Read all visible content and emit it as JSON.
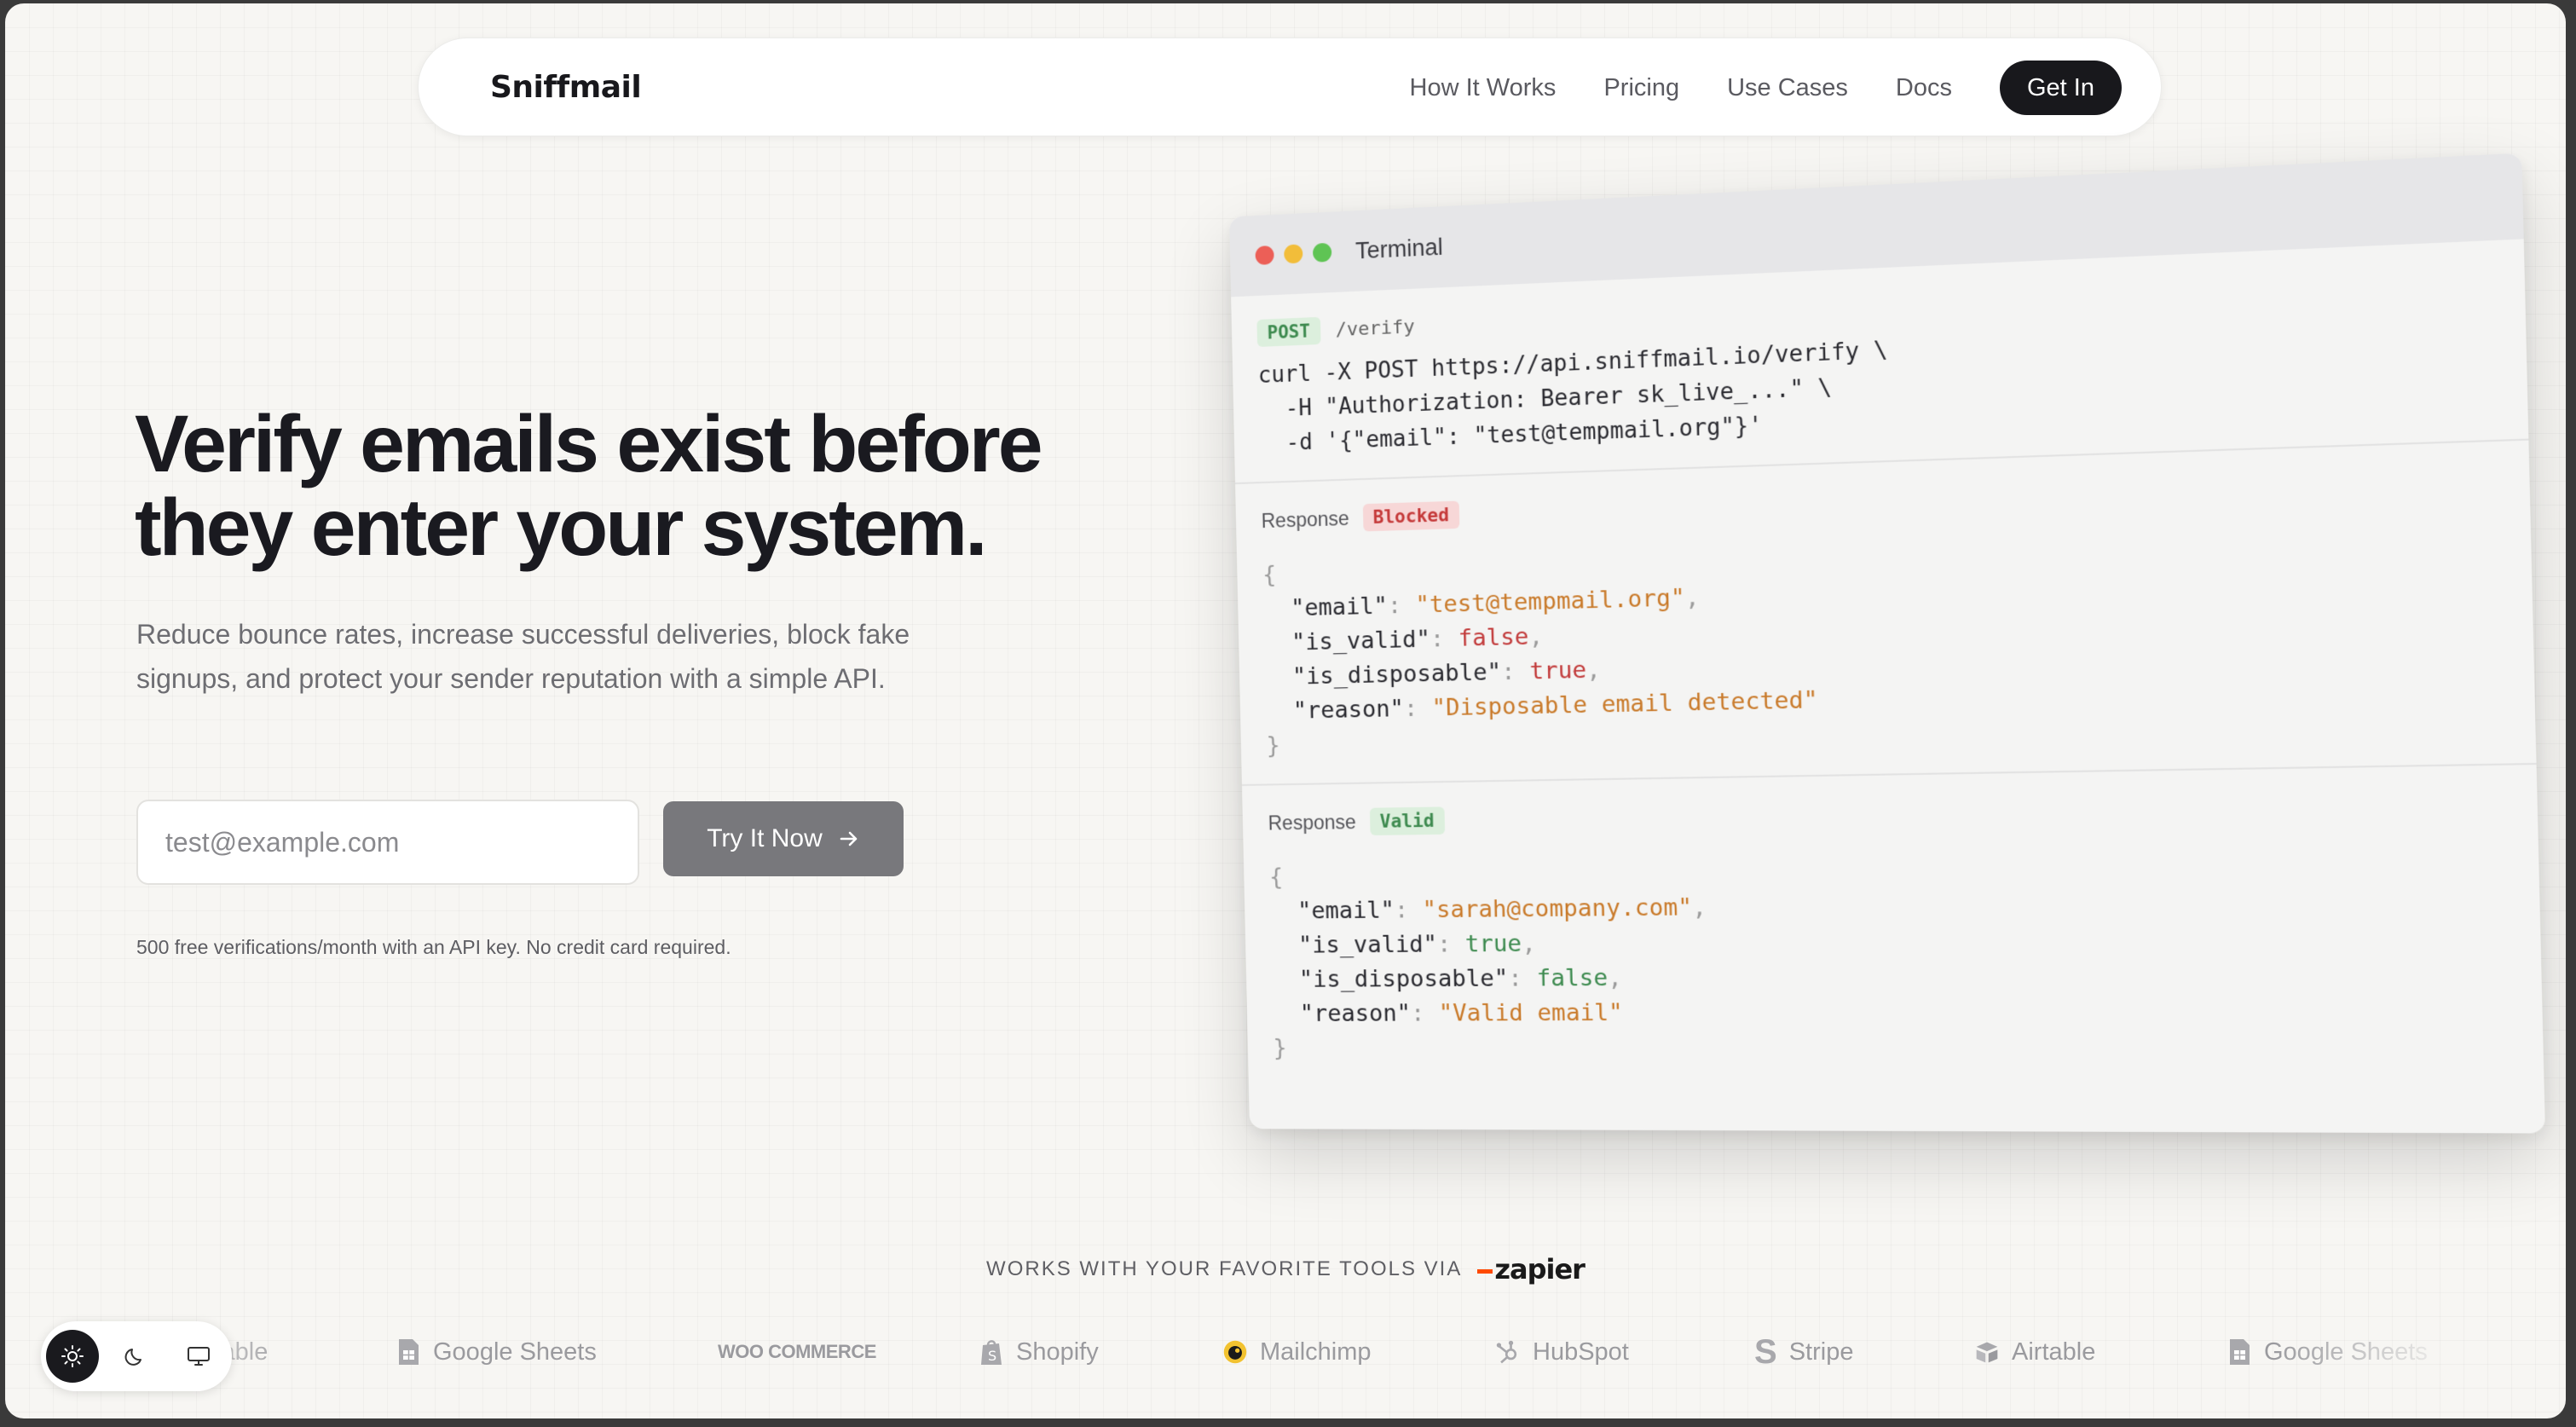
{
  "brand": {
    "name": "Sniffmail"
  },
  "nav": {
    "links": [
      "How It Works",
      "Pricing",
      "Use Cases",
      "Docs"
    ],
    "cta": "Get In"
  },
  "hero": {
    "headline_line1": "Verify emails exist before",
    "headline_line2": "they enter your system.",
    "subtext": "Reduce bounce rates, increase successful deliveries, block fake signups, and protect your sender reputation with a simple API.",
    "input_placeholder": "test@example.com",
    "button_label": "Try It Now",
    "note": "500 free verifications/month with an API key. No credit card required."
  },
  "terminal": {
    "title": "Terminal",
    "method": "POST",
    "path": "/verify",
    "request_code": "curl -X POST https://api.sniffmail.io/verify \\\n  -H \"Authorization: Bearer sk_live_...\" \\\n  -d '{\"email\": \"test@tempmail.org\"}'",
    "response_label": "Response",
    "blocked": {
      "badge": "Blocked",
      "email": "\"test@tempmail.org\"",
      "is_valid": "false",
      "is_disposable": "true",
      "reason": "\"Disposable email detected\""
    },
    "valid": {
      "badge": "Valid",
      "email": "\"sarah@company.com\"",
      "is_valid": "true",
      "is_disposable": "false",
      "reason": "\"Valid email\""
    }
  },
  "integrations": {
    "heading": "WORKS WITH YOUR FAVORITE TOOLS VIA",
    "zapier": "zapier",
    "items": [
      {
        "label": "Airtable",
        "icon": "airtable-icon"
      },
      {
        "label": "Google Sheets",
        "icon": "google-sheets-icon"
      },
      {
        "label": "WOO COMMERCE",
        "icon": "woocommerce-logo"
      },
      {
        "label": "Shopify",
        "icon": "shopify-icon"
      },
      {
        "label": "Mailchimp",
        "icon": "mailchimp-icon"
      },
      {
        "label": "HubSpot",
        "icon": "hubspot-icon"
      },
      {
        "label": "Stripe",
        "icon": "stripe-icon"
      },
      {
        "label": "Airtable",
        "icon": "airtable-icon"
      },
      {
        "label": "Google Sheets",
        "icon": "google-sheets-icon"
      }
    ]
  },
  "theme_switcher": {
    "options": [
      "light",
      "dark",
      "system"
    ],
    "active": "light"
  },
  "colors": {
    "accent_dark": "#18181c",
    "button_gray": "#78787c",
    "green": "#3d8a4f",
    "red": "#c23b3b",
    "orange": "#c97a2a"
  }
}
